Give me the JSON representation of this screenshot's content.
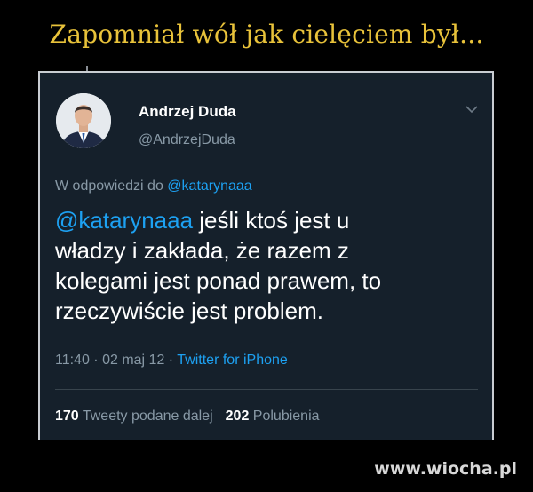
{
  "meme": {
    "title": "Zapomniał wół jak cielęciem był...",
    "watermark": "www.wiocha.pl"
  },
  "tweet": {
    "author_name": "Andrzej Duda",
    "author_handle": "@AndrzejDuda",
    "reply_prefix": "W odpowiedzi do ",
    "reply_to": "@katarynaaa",
    "mention": "@katarynaaa",
    "body": " jeśli ktoś jest u\nwładzy i zakłada, że razem z\nkolegami jest ponad prawem, to\nrzeczywiście jest problem.",
    "time": "11:40",
    "date": "02 maj 12",
    "separator": " · ",
    "source": "Twitter for iPhone",
    "retweets_count": "170",
    "retweets_label": "Tweety podane dalej",
    "likes_count": "202",
    "likes_label": "Polubienia"
  },
  "icons": {
    "menu": "chevron-down-icon",
    "avatar": "profile-photo"
  },
  "colors": {
    "title": "#e8c23a",
    "card_background": "#15202b",
    "link": "#1da1f2",
    "secondary_text": "#8899a6"
  }
}
